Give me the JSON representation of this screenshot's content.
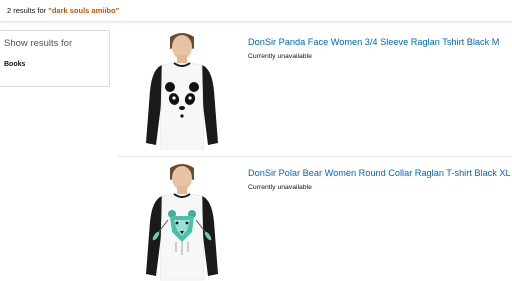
{
  "results": {
    "count_text": "2 results for ",
    "query": "\"dark souls amiibo\""
  },
  "sidebar": {
    "title": "Show results for",
    "items": [
      {
        "label": "Books"
      }
    ]
  },
  "products": [
    {
      "title": "DonSir Panda Face Women 3/4 Sleeve Raglan Tshirt Black M",
      "availability": "Currently unavailable",
      "image_icon": "panda-shirt-icon"
    },
    {
      "title": "DonSir Polar Bear Women Round Collar Raglan T-shirt Black XL",
      "availability": "Currently unavailable",
      "image_icon": "polar-bear-shirt-icon"
    }
  ],
  "colors": {
    "link": "#0066c0",
    "query": "#c45500"
  }
}
